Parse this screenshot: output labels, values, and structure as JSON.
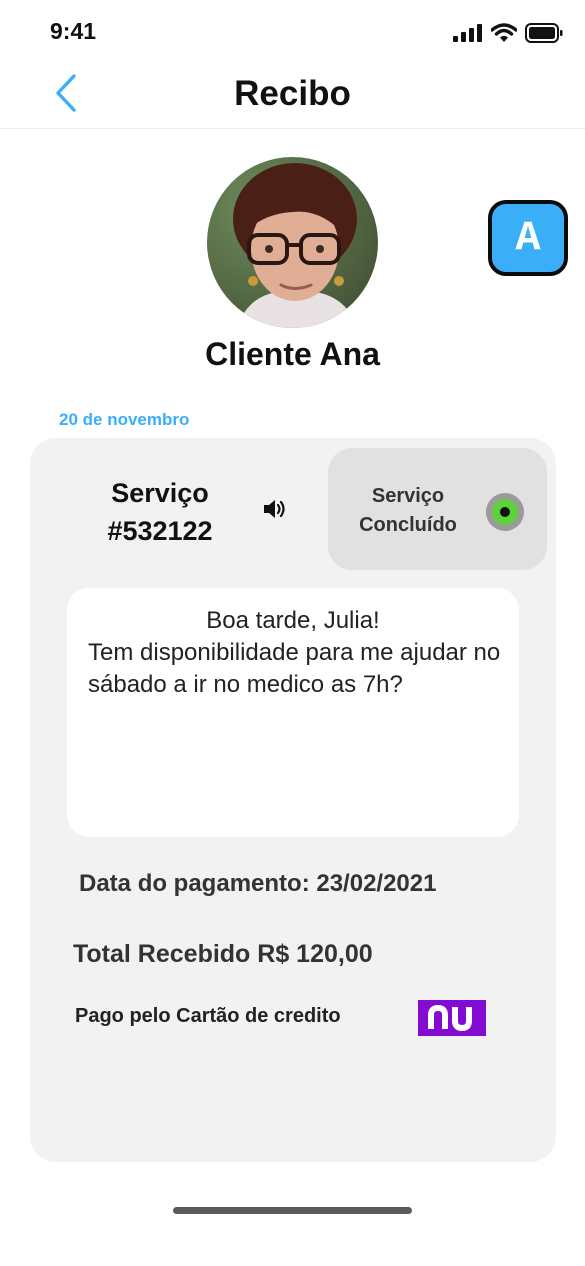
{
  "status_bar": {
    "time": "9:41"
  },
  "header": {
    "title": "Recibo"
  },
  "app_badge": {
    "label": "A"
  },
  "client": {
    "name": "Cliente Ana"
  },
  "date_label": "20 de novembro",
  "card": {
    "service_label": "Serviço",
    "service_number": "#532122",
    "status_line1": "Serviço",
    "status_line2": "Concluído",
    "message_greeting": "Boa tarde, Julia!",
    "message_body": "Tem disponibilidade para me ajudar no sábado a ir no medico as 7h?",
    "payment_date": "Data do pagamento: 23/02/2021",
    "total": "Total Recebido R$ 120,00",
    "paid_by": "Pago pelo Cartão de credito",
    "card_brand": "nu"
  },
  "colors": {
    "accent": "#3aaef7",
    "card_bg": "#f2f2f2",
    "status_box_bg": "#e1e1e1",
    "status_dot": "#5fd13c",
    "nu_purple": "#820ad1"
  }
}
